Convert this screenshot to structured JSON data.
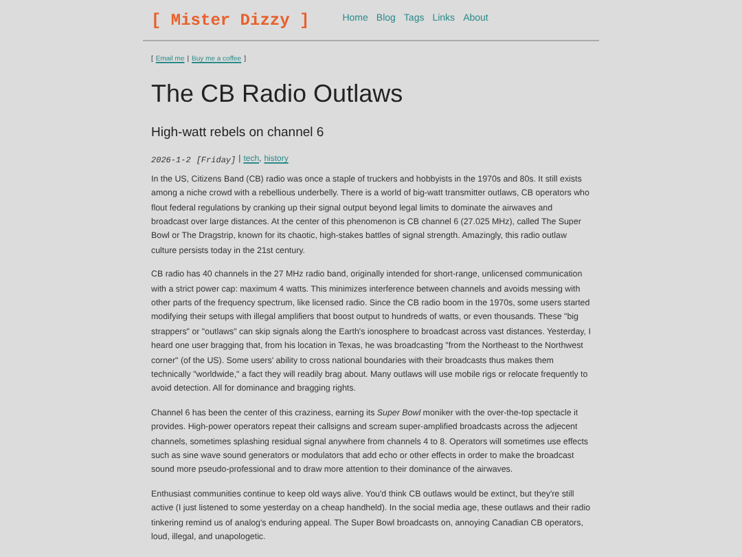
{
  "header": {
    "logo": "[ Mister Dizzy ]",
    "nav": [
      "Home",
      "Blog",
      "Tags",
      "Links",
      "About"
    ]
  },
  "contact": {
    "open": "[",
    "links": [
      "Email me",
      "Buy me a coffee"
    ],
    "separator": "|",
    "close": "]"
  },
  "article": {
    "title": "The CB Radio Outlaws",
    "subtitle": "High-watt rebels on channel 6",
    "meta": {
      "date": "2026-1-2",
      "day": "[Friday]",
      "separator": "|",
      "tags": [
        "tech",
        "history"
      ],
      "tag_separator": ","
    },
    "paragraphs": [
      "In the US, Citizens Band (CB) radio was once a staple of truckers and hobbyists in the 1970s and 80s. It still exists among a niche crowd with a rebellious underbelly. There is a world of big-watt transmitter outlaws, CB operators who flout federal regulations by cranking up their signal output beyond legal limits to dominate the airwaves and broadcast over large distances. At the center of this phenomenon is CB channel 6 (27.025 MHz), called The Super Bowl or The Dragstrip, known for its chaotic, high-stakes battles of signal strength. Amazingly, this radio outlaw culture persists today in the 21st century.",
      "CB radio has 40 channels in the 27 MHz radio band, originally intended for short-range, unlicensed communication with a strict power cap: maximum 4 watts. This minimizes interference between channels and avoids messing with other parts of the frequency spectrum, like licensed radio. Since the CB radio boom in the 1970s, some users started modifying their setups with illegal amplifiers that boost output to hundreds of watts, or even thousands. These \"big strappers\" or \"outlaws\" can skip signals along the Earth's ionosphere to broadcast across vast distances. Yesterday, I heard one user bragging that, from his location in Texas, he was broadcasting \"from the Northeast to the Northwest corner\" (of the US). Some users' ability to cross national boundaries with their broadcasts thus makes them technically \"worldwide,\" a fact they will readily brag about. Many outlaws will use mobile rigs or relocate frequently to avoid detection. All for dominance and bragging rights.",
      "Channel 6 has been the center of this craziness, earning its *Super Bowl* moniker with the over-the-top spectacle it provides. High-power operators repeat their callsigns and scream super-amplified broadcasts across the adjecent channels, sometimes splashing residual signal anywhere from channels 4 to 8. Operators will sometimes use effects such as sine wave sound generators or modulators that add echo or other effects in order to make the broadcast sound more pseudo-professional and to draw more attention to their dominance of the airwaves.",
      "Enthusiast communities continue to keep old ways alive. You'd think CB outlaws would be extinct, but they're still active (I just listened to some yesterday on a cheap handheld). In the social media age, these outlaws and their radio tinkering remind us of analog's enduring appeal. The Super Bowl broadcasts on, annoying Canadian CB operators, loud, illegal, and unapologetic."
    ]
  }
}
